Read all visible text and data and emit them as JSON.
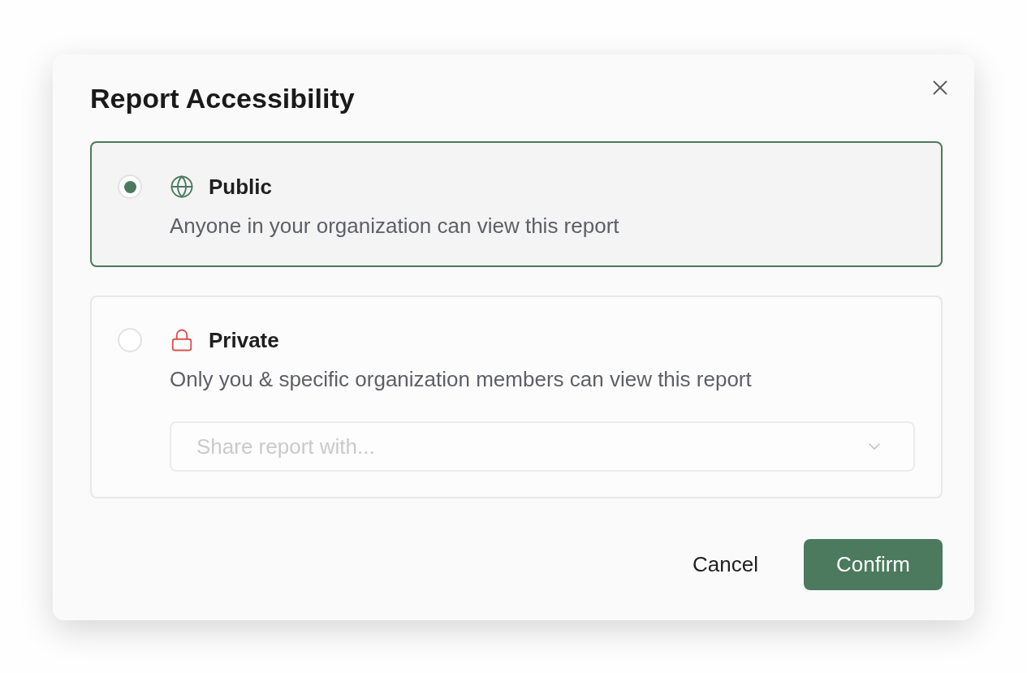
{
  "dialog": {
    "title": "Report Accessibility",
    "options": [
      {
        "kind": "public",
        "label": "Public",
        "description": "Anyone in your organization can view this report",
        "selected": true
      },
      {
        "kind": "private",
        "label": "Private",
        "description": "Only you & specific organization members can view this report",
        "selected": false,
        "share_field": {
          "placeholder": "Share report with..."
        }
      }
    ],
    "buttons": [
      {
        "kind": "secondary",
        "label": "Cancel"
      },
      {
        "kind": "primary",
        "label": "Confirm"
      }
    ]
  }
}
